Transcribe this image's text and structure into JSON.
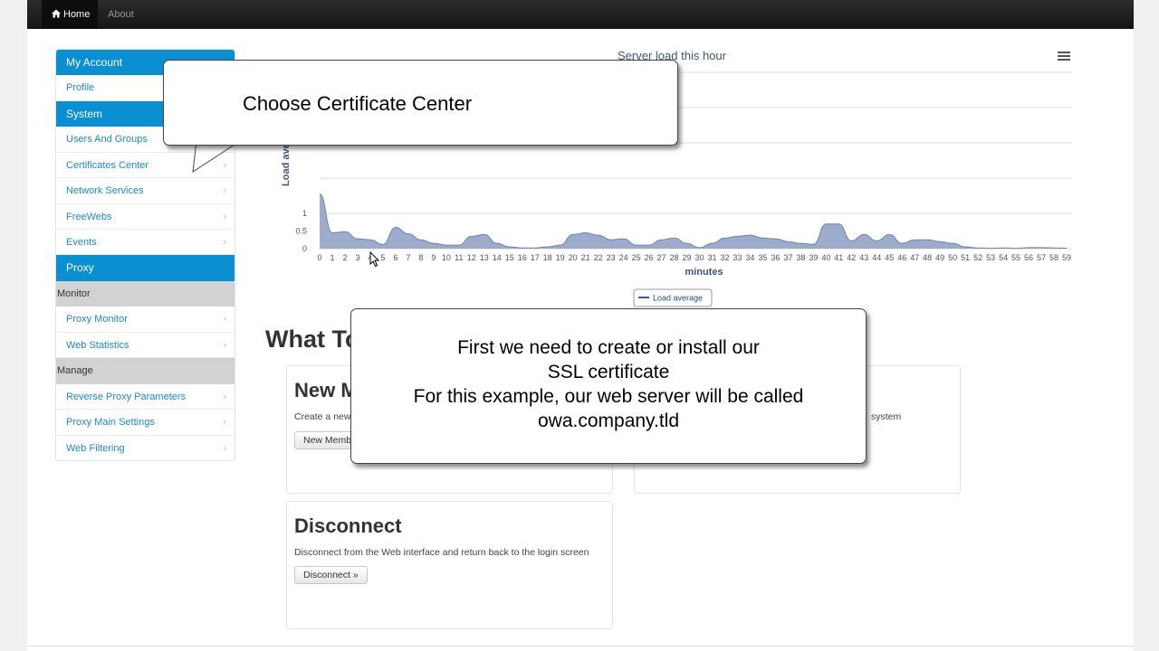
{
  "navbar": {
    "home": "Home",
    "about": "About"
  },
  "sidebar": {
    "my_account": "My Account",
    "profile": "Profile",
    "system": "System",
    "users_and_groups": "Users And Groups",
    "certificates_center": "Certificates Center",
    "network_services": "Network Services",
    "freewebs": "FreeWebs",
    "events": "Events",
    "proxy": "Proxy",
    "monitor": "Monitor",
    "proxy_monitor": "Proxy Monitor",
    "web_statistics": "Web Statistics",
    "manage": "Manage",
    "reverse_proxy_parameters": "Reverse Proxy Parameters",
    "proxy_main_settings": "Proxy Main Settings",
    "web_filtering": "Web Filtering"
  },
  "chart_data": {
    "type": "area",
    "title": "Server load this hour",
    "xlabel": "minutes",
    "ylabel": "Load aver",
    "ylim": [
      0,
      1
    ],
    "yticks": [
      "0",
      "0.5",
      "1"
    ],
    "x": [
      0,
      1,
      2,
      3,
      4,
      5,
      6,
      7,
      8,
      9,
      10,
      11,
      12,
      13,
      14,
      15,
      16,
      17,
      18,
      19,
      20,
      21,
      22,
      23,
      24,
      25,
      26,
      27,
      28,
      29,
      30,
      31,
      32,
      33,
      34,
      35,
      36,
      37,
      38,
      39,
      40,
      41,
      42,
      43,
      44,
      45,
      46,
      47,
      48,
      49,
      50,
      51,
      52,
      53,
      54,
      55,
      56,
      57,
      58,
      59
    ],
    "series": [
      {
        "name": "Load average",
        "values": [
          1.55,
          0.45,
          0.48,
          0.28,
          0.25,
          0.12,
          0.6,
          0.42,
          0.25,
          0.15,
          0.1,
          0.1,
          0.35,
          0.4,
          0.15,
          0.05,
          0.02,
          0.02,
          0.05,
          0.1,
          0.4,
          0.45,
          0.38,
          0.25,
          0.28,
          0.1,
          0.1,
          0.25,
          0.3,
          0.15,
          0.03,
          0.15,
          0.3,
          0.35,
          0.38,
          0.3,
          0.28,
          0.2,
          0.15,
          0.12,
          0.7,
          0.7,
          0.22,
          0.4,
          0.22,
          0.4,
          0.15,
          0.25,
          0.25,
          0.2,
          0.15,
          0.05,
          0.02,
          0.01,
          0.02,
          0.01,
          0.03,
          0.03,
          0.02,
          0.01
        ]
      }
    ],
    "legend": "bottom-center",
    "grid": true,
    "color": "#8c9ec4"
  },
  "what_to_do": {
    "title": "What To Do ?",
    "card1": {
      "title": "New Member",
      "text": "Create a new member",
      "button": "New Member »"
    },
    "card2": {
      "text": "system"
    },
    "card3": {
      "title": "Disconnect",
      "text": "Disconnect from the Web interface and return back to the login screen",
      "button": "Disconnect »"
    }
  },
  "callouts": {
    "first": "Choose Certificate Center",
    "second": [
      "First we need to create or install our",
      "SSL certificate",
      "For this example, our web server will be called",
      "owa.company.tld"
    ]
  }
}
